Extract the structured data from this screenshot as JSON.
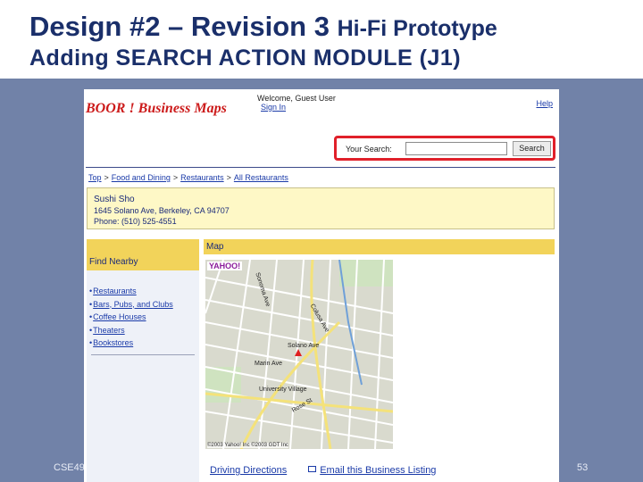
{
  "slide": {
    "title_main": "Design #2 – Revision 3 ",
    "title_sub": "Hi-Fi Prototype",
    "title_line2": "Adding SEARCH ACTION MODULE (J1)",
    "footer_left": "CSE49",
    "page_number": "53"
  },
  "site": {
    "logo_text": "BOOR ! Business Maps",
    "welcome": "Welcome, Guest User",
    "sign_in": "Sign In",
    "help": "Help",
    "search_label": "Your Search:",
    "search_value": "",
    "search_button": "Search",
    "highlight_color": "#e0202a"
  },
  "breadcrumb": [
    "Top",
    "Food and Dining",
    "Restaurants",
    "All Restaurants"
  ],
  "business": {
    "name": "Sushi Sho",
    "address": "1645 Solano Ave, Berkeley, CA 94707",
    "phone": "Phone: (510) 525-4551"
  },
  "find_nearby": {
    "title": "Find Nearby",
    "items": [
      "Restaurants",
      "Bars, Pubs, and Clubs",
      "Coffee Houses",
      "Theaters",
      "Bookstores"
    ]
  },
  "map": {
    "title": "Map",
    "logo": "YAHOO!",
    "labels": [
      "Sonoma Ave",
      "Colusa Ave",
      "Solano Ave",
      "Marin Ave",
      "University Village",
      "Rose St"
    ],
    "copyright": "©2003 Yahoo! Inc ©2003 GDT Inc"
  },
  "bottom": {
    "driving_directions": "Driving Directions",
    "email_listing": "Email this Business Listing"
  }
}
